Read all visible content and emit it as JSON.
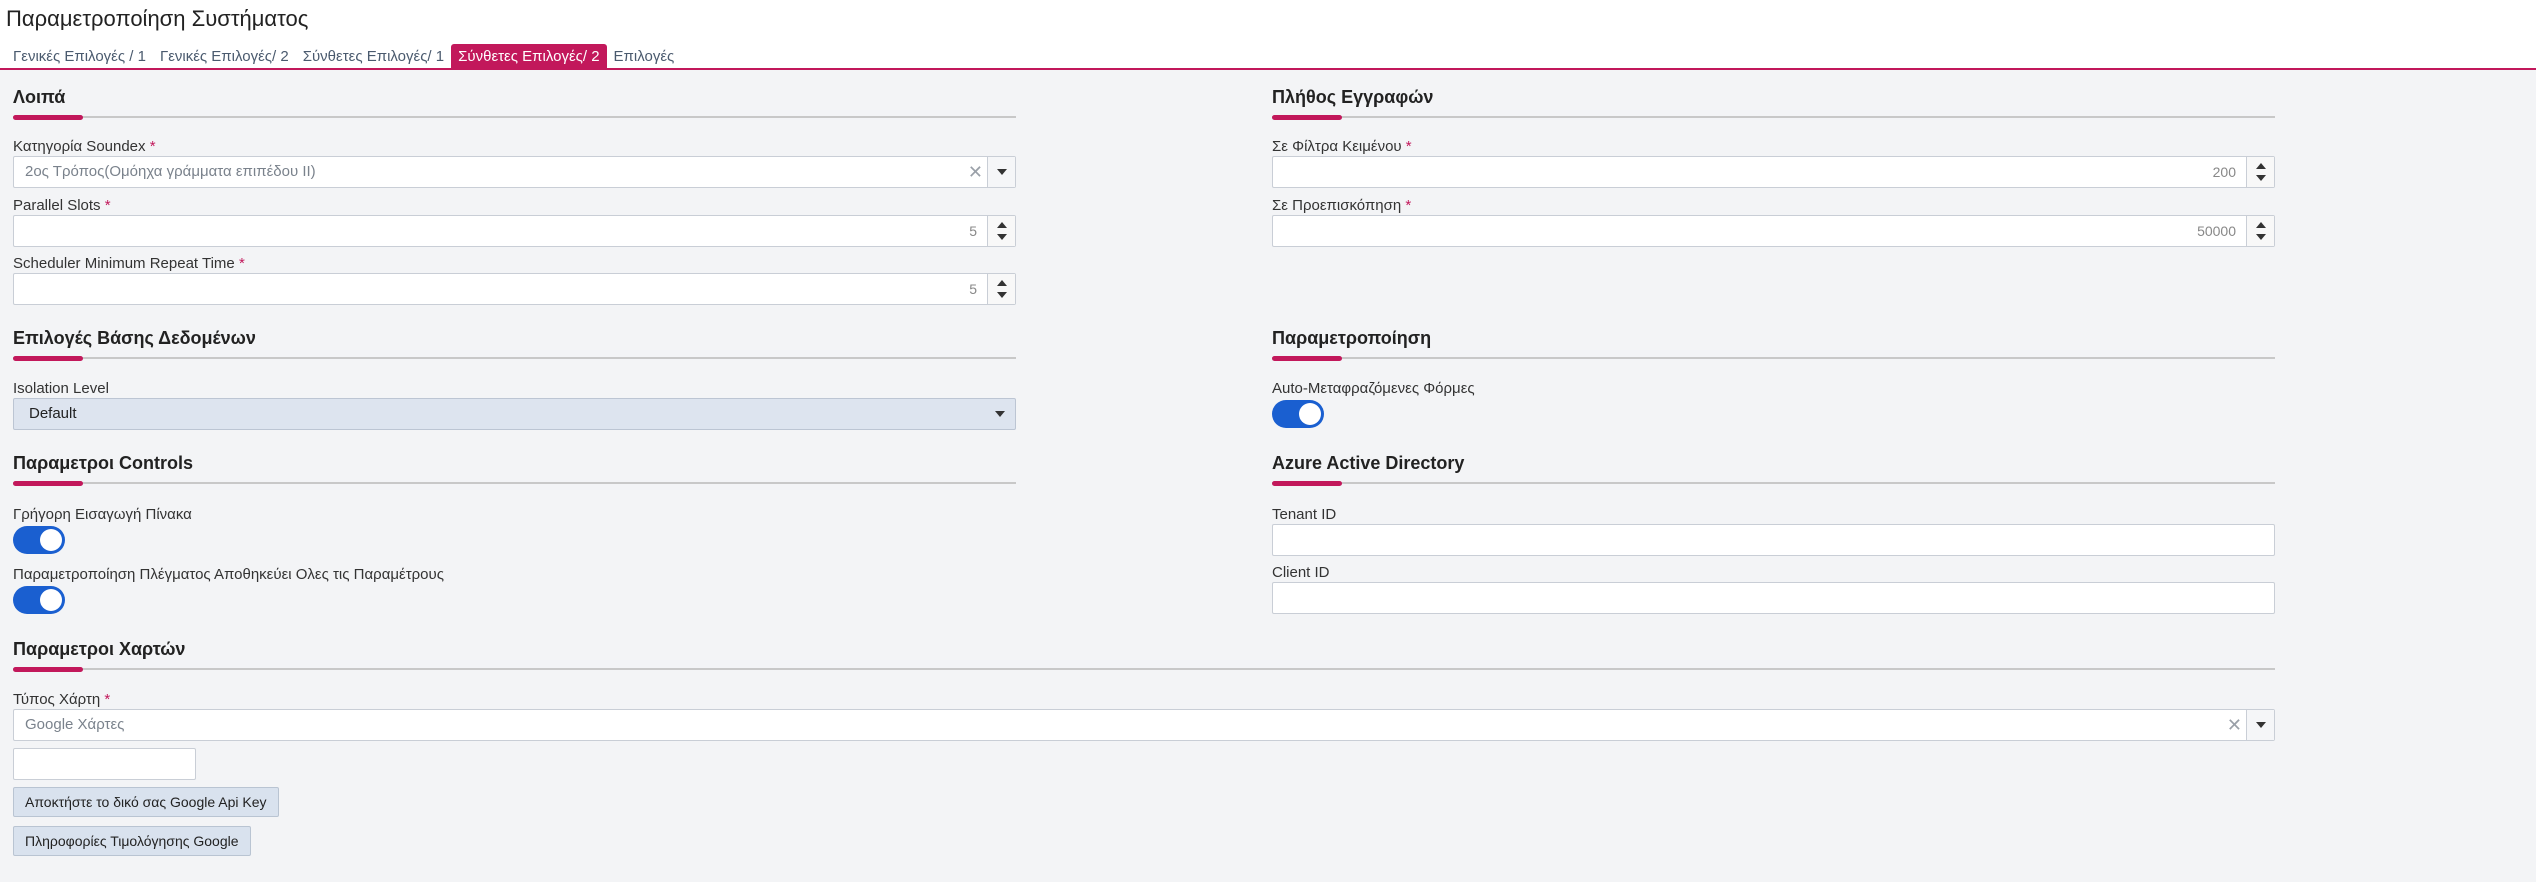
{
  "header": {
    "title": "Παραμετροποίηση Συστήματος",
    "tabs": [
      {
        "label": "Γενικές Επιλογές / 1"
      },
      {
        "label": "Γενικές Επιλογές/ 2"
      },
      {
        "label": "Σύνθετες Επιλογές/ 1"
      },
      {
        "label": "Σύνθετες Επιλογές/ 2"
      },
      {
        "label": "Επιλογές"
      }
    ],
    "active_tab": "Σύνθετες Επιλογές/ 2"
  },
  "loipa": {
    "title": "Λοιπά",
    "soundex": {
      "label": "Κατηγορία Soundex",
      "value": "2ος Τρόπος(Ομόηχα γράμματα επιπέδου ΙΙ)"
    },
    "parallel_slots": {
      "label": "Parallel Slots",
      "value": "5"
    },
    "scheduler": {
      "label": "Scheduler Minimum Repeat Time",
      "value": "5"
    }
  },
  "records": {
    "title": "Πλήθος Εγγραφών",
    "text_filters": {
      "label": "Σε Φίλτρα Κειμένου",
      "value": "200"
    },
    "preview": {
      "label": "Σε Προεπισκόπηση",
      "value": "50000"
    }
  },
  "db": {
    "title": "Επιλογές Βάσης Δεδομένων",
    "isolation": {
      "label": "Isolation Level",
      "value": "Default"
    }
  },
  "param": {
    "title": "Παραμετροποίηση",
    "auto_translate": {
      "label": "Auto-Μεταφραζόμενες Φόρμες",
      "checked": true
    }
  },
  "controls": {
    "title": "Παραμετροι Controls",
    "fast_insert": {
      "label": "Γρήγορη Εισαγωγή Πίνακα",
      "checked": true
    },
    "grid_save": {
      "label": "Παραμετροποίηση Πλέγματος Αποθηκεύει Ολες τις Παραμέτρους",
      "checked": true
    }
  },
  "azure": {
    "title": "Azure Active Directory",
    "tenant": {
      "label": "Tenant ID",
      "value": ""
    },
    "client": {
      "label": "Client ID",
      "value": ""
    }
  },
  "maps": {
    "title": "Παραμετροι Χαρτών",
    "map_type": {
      "label": "Τύπος Χάρτη",
      "value": "Google Χάρτες"
    },
    "api_key_value": "",
    "api_key_button": "Αποκτήστε το δικό σας Google Api Key",
    "pricing_button": "Πληροφορίες Τιμολόγησης Google"
  },
  "required_mark": "*",
  "colors": {
    "accent": "#c2185b",
    "toggle_on": "#1a5fd0",
    "button_bg": "#d9e2ee"
  },
  "icons": {
    "clear": "close-icon",
    "dropdown": "chevron-down-icon",
    "spin_up": "caret-up-icon",
    "spin_down": "caret-down-icon"
  }
}
